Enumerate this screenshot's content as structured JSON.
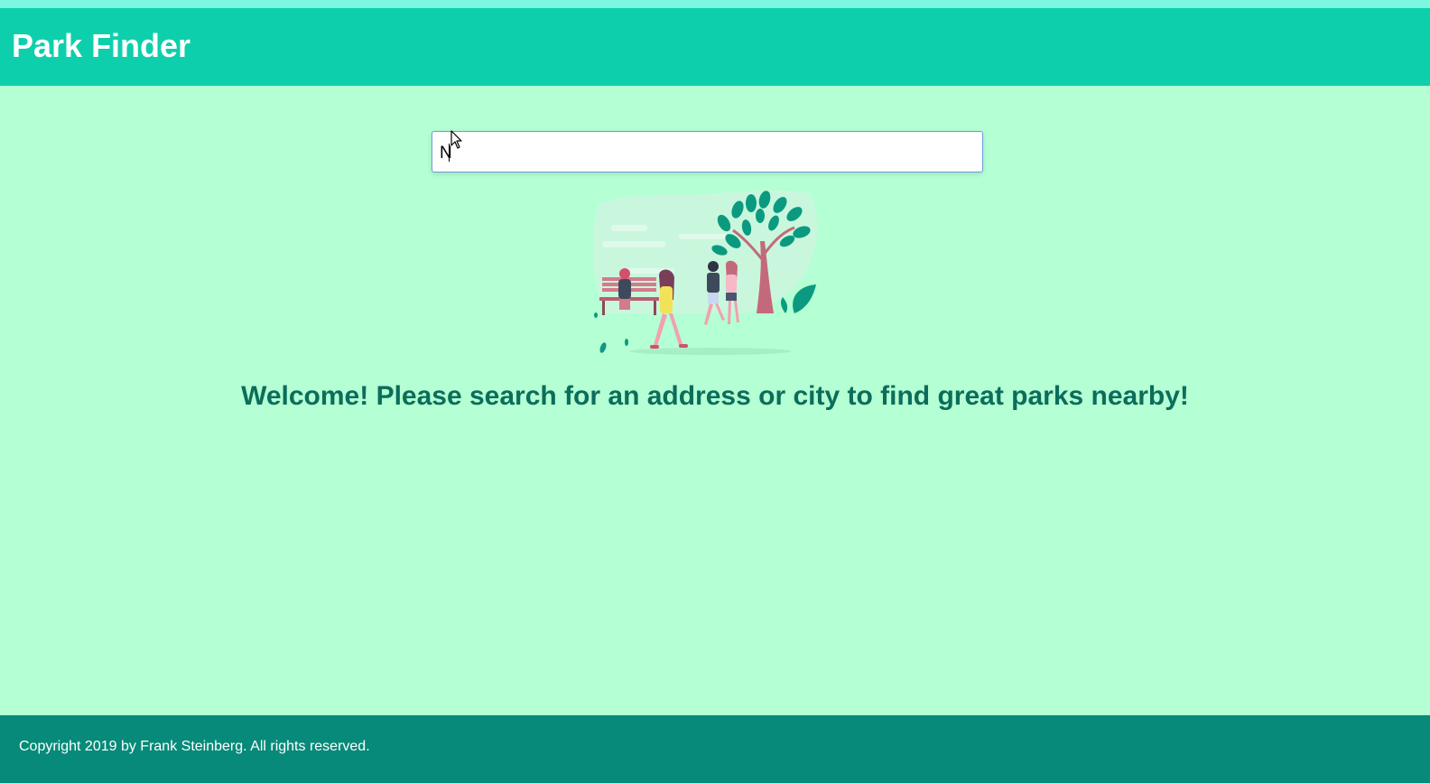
{
  "header": {
    "title": "Park Finder"
  },
  "search": {
    "value": "N",
    "placeholder": ""
  },
  "main": {
    "welcome_text": "Welcome! Please search for an address or city to find great parks nearby!",
    "illustration": "park-people-illustration"
  },
  "footer": {
    "copyright": "Copyright 2019 by Frank Steinberg. All rights reserved."
  },
  "colors": {
    "background": "#b4ffd4",
    "header": "#0ecfac",
    "footer": "#078a79",
    "welcome_text": "#0b6d5a",
    "input_border": "#6a9bdc"
  }
}
